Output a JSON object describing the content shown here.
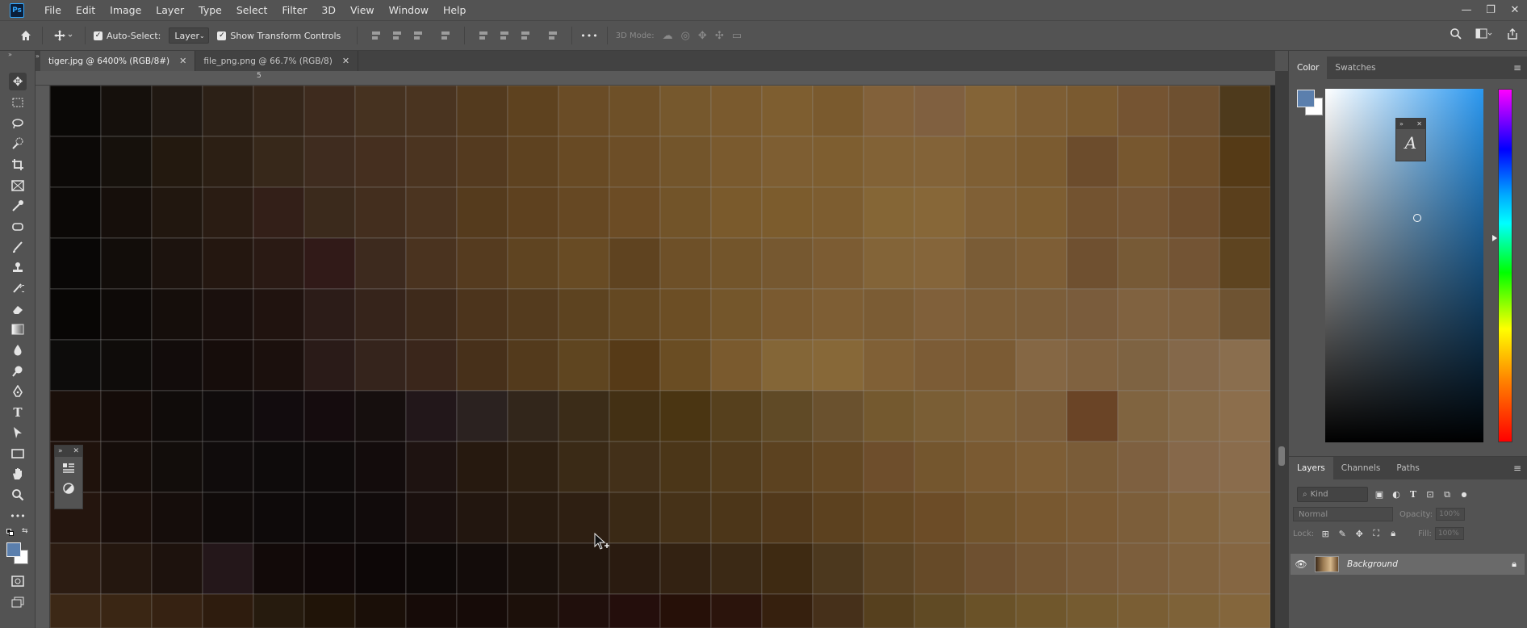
{
  "app": {
    "logo": "Ps"
  },
  "menu": [
    "File",
    "Edit",
    "Image",
    "Layer",
    "Type",
    "Select",
    "Filter",
    "3D",
    "View",
    "Window",
    "Help"
  ],
  "window_controls": {
    "minimize": "—",
    "restore": "❐",
    "close": "✕"
  },
  "options_bar": {
    "auto_select_label": "Auto-Select:",
    "auto_select_target": "Layer",
    "show_transform_label": "Show Transform Controls",
    "more": "•••",
    "mode_3d_label": "3D Mode:"
  },
  "tabs": [
    {
      "label": "tiger.jpg @ 6400% (RGB/8#)",
      "close": "✕"
    },
    {
      "label": "file_png.png @ 66.7% (RGB/8)",
      "close": "✕"
    }
  ],
  "ruler": {
    "tick": "5"
  },
  "canvas": {
    "grid_cols": 24,
    "grid_rows": 11,
    "pixel_colors": [
      [
        "#0a0806",
        "#15100c",
        "#201812",
        "#2c2016",
        "#35261a",
        "#3e2b1e",
        "#463220",
        "#4a3420",
        "#533a1e",
        "#5e421f",
        "#6a4c26",
        "#6e5028",
        "#76582d",
        "#7a5a2e",
        "#7e5e30",
        "#7a5a2e",
        "#82613a",
        "#806040",
        "#846437",
        "#7e5e34",
        "#7a5a30",
        "#755432",
        "#6e5030",
        "#4e3a1c"
      ],
      [
        "#0c0907",
        "#16110c",
        "#23190f",
        "#2c1f14",
        "#37281a",
        "#3f2c1f",
        "#452f1f",
        "#4b3420",
        "#543a1f",
        "#5e4220",
        "#684a24",
        "#6d4e27",
        "#73552b",
        "#7a5a2e",
        "#7e5e32",
        "#7e5e30",
        "#826236",
        "#836338",
        "#7f5f34",
        "#7b5b30",
        "#6c4c2c",
        "#77572f",
        "#6f4f2b",
        "#553a16"
      ],
      [
        "#0b0806",
        "#160f0b",
        "#21170f",
        "#2a1c13",
        "#331f18",
        "#3b2a1c",
        "#432e1e",
        "#4b3420",
        "#553b1d",
        "#5e411f",
        "#664823",
        "#6c4c25",
        "#725429",
        "#7a5a2c",
        "#7c5c2d",
        "#7d5d30",
        "#856636",
        "#876738",
        "#806036",
        "#7e5e32",
        "#735330",
        "#765634",
        "#6e4e2e",
        "#5a3f1c"
      ],
      [
        "#090706",
        "#120d0a",
        "#1c130e",
        "#241710",
        "#2a1a14",
        "#311a18",
        "#3d2a1e",
        "#4a331f",
        "#553b1f",
        "#5f4421",
        "#684b24",
        "#5f4320",
        "#6e5028",
        "#73552b",
        "#765830",
        "#7c5c33",
        "#836438",
        "#85653a",
        "#7a5c36",
        "#7e5e36",
        "#6f5030",
        "#775a36",
        "#735434",
        "#5e4420"
      ],
      [
        "#080605",
        "#0e0a08",
        "#150e0b",
        "#1a100d",
        "#20130f",
        "#2c1c18",
        "#36241b",
        "#3e2a1b",
        "#4c341c",
        "#543b1e",
        "#5d4320",
        "#644822",
        "#6c4e25",
        "#74562b",
        "#7a5a30",
        "#7e5e34",
        "#7b5c34",
        "#80603a",
        "#7d5e38",
        "#7c5e3a",
        "#7a5c3c",
        "#806240",
        "#7e603e",
        "#6e5332"
      ],
      [
        "#0d0c0b",
        "#0f0c0a",
        "#120c0b",
        "#160d0b",
        "#1b100d",
        "#2a1b18",
        "#35241c",
        "#3a261b",
        "#47301a",
        "#533a1c",
        "#5f4520",
        "#563a17",
        "#6a4d23",
        "#7a5a2e",
        "#846637",
        "#876838",
        "#806036",
        "#7c5c36",
        "#7b5b34",
        "#856744",
        "#806240",
        "#7e6342",
        "#84684a",
        "#8a6e4e"
      ],
      [
        "#1a0f0a",
        "#140c09",
        "#100c0a",
        "#100c0c",
        "#120c0e",
        "#150c0e",
        "#160f0e",
        "#22171a",
        "#2b2220",
        "#32261b",
        "#3b2c18",
        "#433014",
        "#4a3512",
        "#56401d",
        "#604a26",
        "#6a512e",
        "#74592f",
        "#7a5e35",
        "#7e6038",
        "#7c5e3a",
        "#6a4426",
        "#806440",
        "#866a48",
        "#8c6e4c"
      ],
      [
        "#1f120c",
        "#150d0a",
        "#120d0b",
        "#100c0c",
        "#0e0b0b",
        "#0f0b0b",
        "#130c0c",
        "#1e1311",
        "#26190f",
        "#2e2012",
        "#3a2a16",
        "#433019",
        "#4b3618",
        "#533c1c",
        "#5c4220",
        "#644824",
        "#6e4e2c",
        "#74562e",
        "#7a5a32",
        "#7e5e36",
        "#7a5c38",
        "#7e6040",
        "#86684a",
        "#8a6c4c"
      ],
      [
        "#24150e",
        "#1a0f0b",
        "#150d0b",
        "#100b0a",
        "#0e0a0a",
        "#0e0a0a",
        "#110b0b",
        "#1a100e",
        "#22160f",
        "#281b10",
        "#2e1f12",
        "#3a2915",
        "#463218",
        "#4c3619",
        "#52391b",
        "#5c411f",
        "#654823",
        "#6c4c27",
        "#72542c",
        "#785830",
        "#7a5a34",
        "#7c5e3a",
        "#82643e",
        "#876a46"
      ],
      [
        "#2c1c12",
        "#24170f",
        "#1d120d",
        "#24171a",
        "#120a09",
        "#100808",
        "#0d0707",
        "#0e0908",
        "#130c0a",
        "#1a110c",
        "#22160e",
        "#2a1b10",
        "#332212",
        "#3b2915",
        "#3e2a12",
        "#4c381e",
        "#5c4424",
        "#664a28",
        "#6e5030",
        "#745634",
        "#785a38",
        "#7c5e3c",
        "#80623e",
        "#856642"
      ],
      [
        "#3c2816",
        "#3a2614",
        "#362212",
        "#2e1c0e",
        "#261b0e",
        "#201408",
        "#1a0f08",
        "#160b08",
        "#160b08",
        "#1c100a",
        "#200f0c",
        "#240e0c",
        "#261008",
        "#2b140c",
        "#36200e",
        "#46301a",
        "#56401e",
        "#604a24",
        "#6a5228",
        "#70572c",
        "#755b30",
        "#7a5e34",
        "#7e6238",
        "#84663c"
      ]
    ]
  },
  "color_panel": {
    "tabs": [
      "Color",
      "Swatches"
    ],
    "foreground": "#5b7fad",
    "background": "#ffffff",
    "hue_color": "#2a97ef"
  },
  "char_float": {
    "glyph": "A"
  },
  "layers_panel": {
    "tabs": [
      "Layers",
      "Channels",
      "Paths"
    ],
    "kind_placeholder": "Kind",
    "blend_mode": "Normal",
    "opacity_label": "Opacity:",
    "opacity_value": "100%",
    "lock_label": "Lock:",
    "fill_label": "Fill:",
    "fill_value": "100%",
    "layers": [
      {
        "name": "Background",
        "visible": true,
        "locked": true
      }
    ]
  }
}
